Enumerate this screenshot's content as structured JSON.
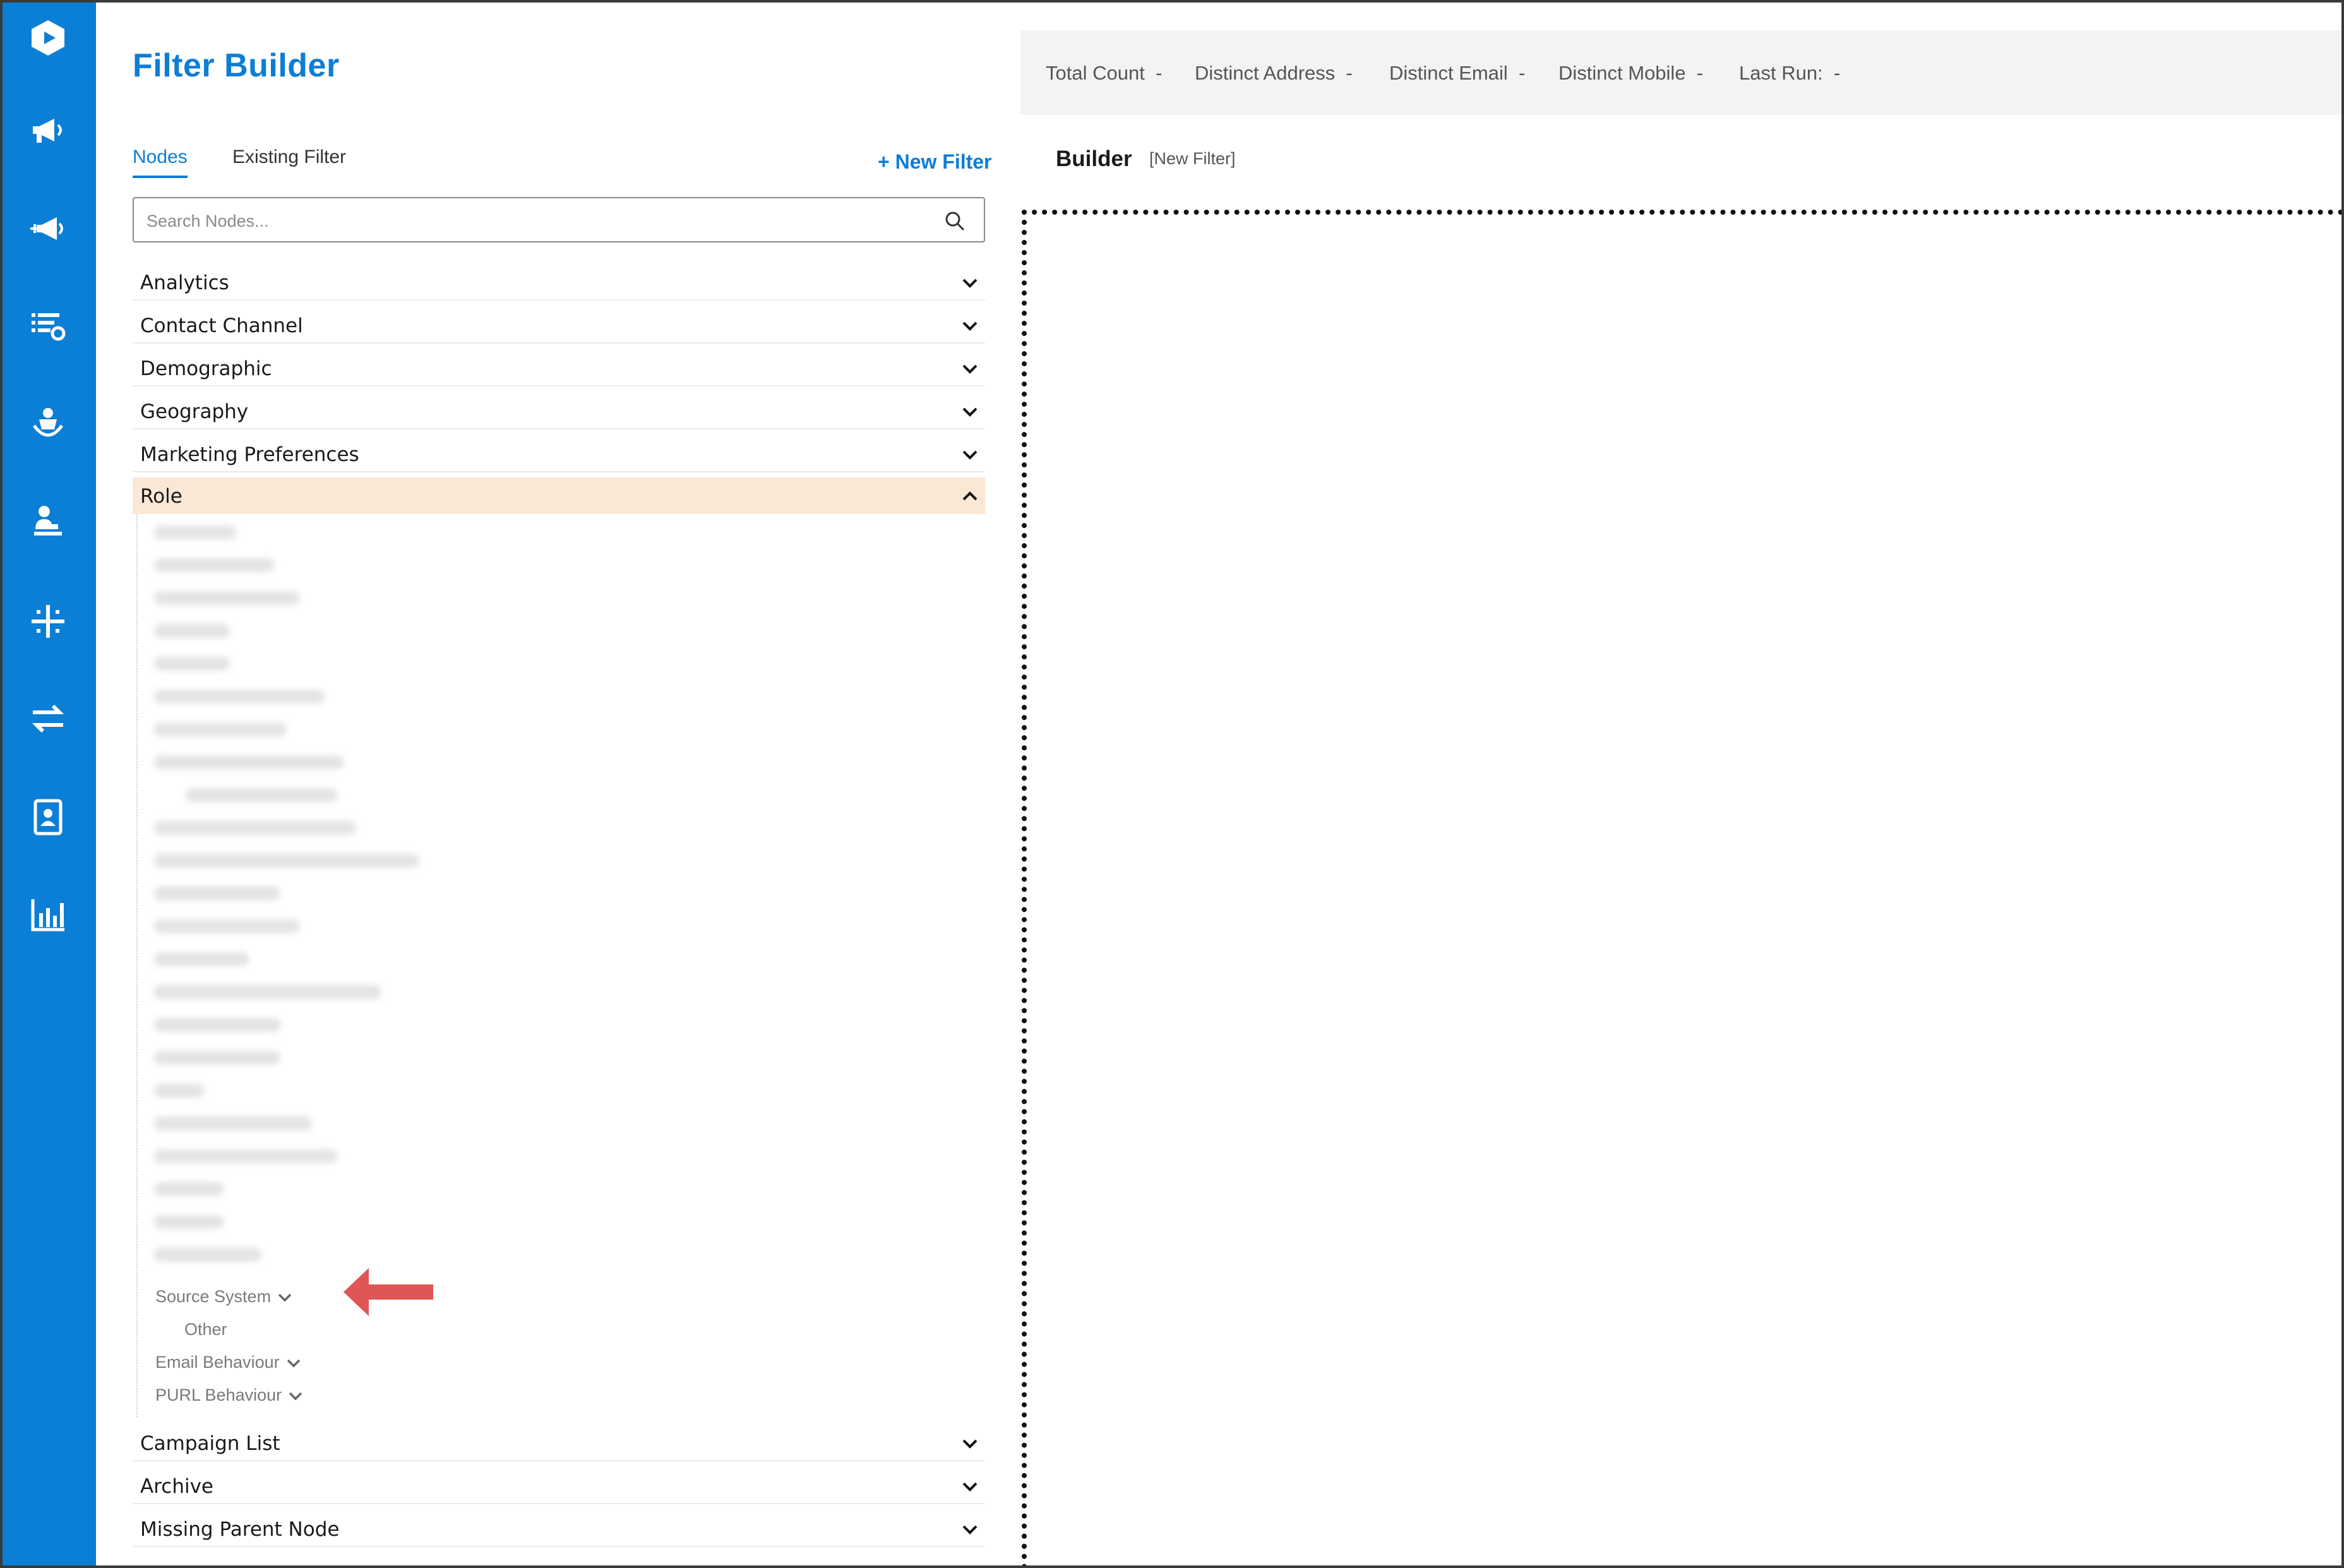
{
  "app": {
    "title": "Filter Builder"
  },
  "sidebar": {
    "icons": [
      "logo-icon",
      "megaphone-icon",
      "megaphone-add-icon",
      "list-settings-icon",
      "person-hand-icon",
      "person-desk-icon",
      "network-icon",
      "transfer-icon",
      "contact-card-icon",
      "bar-chart-icon"
    ]
  },
  "tabs": [
    {
      "label": "Nodes",
      "active": true
    },
    {
      "label": "Existing Filter",
      "active": false
    }
  ],
  "new_filter_label": "+ New Filter",
  "search": {
    "placeholder": "Search Nodes..."
  },
  "nodes": [
    {
      "label": "Analytics",
      "expanded": false
    },
    {
      "label": "Contact Channel",
      "expanded": false
    },
    {
      "label": "Demographic",
      "expanded": false
    },
    {
      "label": "Geography",
      "expanded": false
    },
    {
      "label": "Marketing Preferences",
      "expanded": false
    },
    {
      "label": "Role",
      "expanded": true
    },
    {
      "label": "Campaign List",
      "expanded": false
    },
    {
      "label": "Archive",
      "expanded": false
    },
    {
      "label": "Missing Parent Node",
      "expanded": false
    }
  ],
  "role_children": {
    "source_system": "Source System",
    "other": "Other",
    "email_behaviour": "Email Behaviour",
    "purl_behaviour": "PURL Behaviour"
  },
  "stats": {
    "total_count": "Total Count",
    "total_count_value": "-",
    "distinct_address": "Distinct Address",
    "distinct_address_value": "-",
    "distinct_email": "Distinct Email",
    "distinct_email_value": "-",
    "distinct_mobile": "Distinct Mobile",
    "distinct_mobile_value": "-",
    "last_run": "Last Run:",
    "last_run_value": "-"
  },
  "builder": {
    "title": "Builder",
    "subtitle": "[New Filter]"
  },
  "colors": {
    "brand": "#0b7ed6",
    "role_highlight": "#fbe7d6",
    "arrow": "#e05555"
  }
}
